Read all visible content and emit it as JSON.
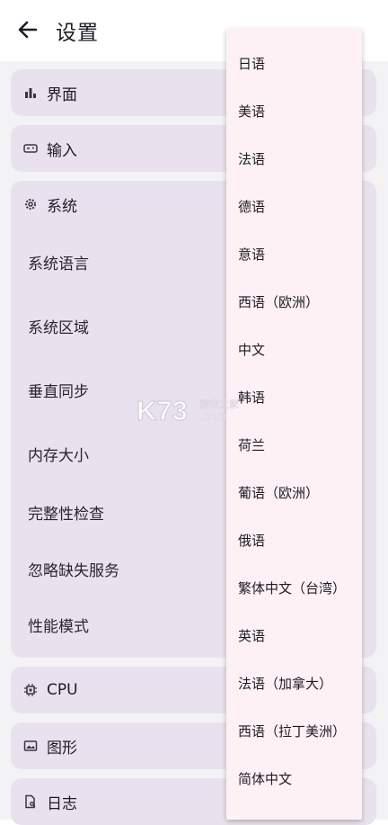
{
  "header": {
    "title": "设置"
  },
  "sections": {
    "ui": "界面",
    "input": "输入",
    "system": "系统",
    "cpu": "CPU",
    "graphics": "图形",
    "log": "日志"
  },
  "system_items": [
    "系统语言",
    "系统区域",
    "垂直同步",
    "内存大小",
    "完整性检查",
    "忽略缺失服务",
    "性能模式"
  ],
  "language_options": [
    "日语",
    "美语",
    "法语",
    "德语",
    "意语",
    "西语（欧洲）",
    "中文",
    "韩语",
    "荷兰",
    "葡语（欧洲）",
    "俄语",
    "繁体中文（台湾）",
    "英语",
    "法语（加拿大）",
    "西语（拉丁美洲）",
    "简体中文"
  ],
  "watermark": {
    "text1": "K73",
    "text2": "游戏之家",
    "text3": ".com"
  }
}
